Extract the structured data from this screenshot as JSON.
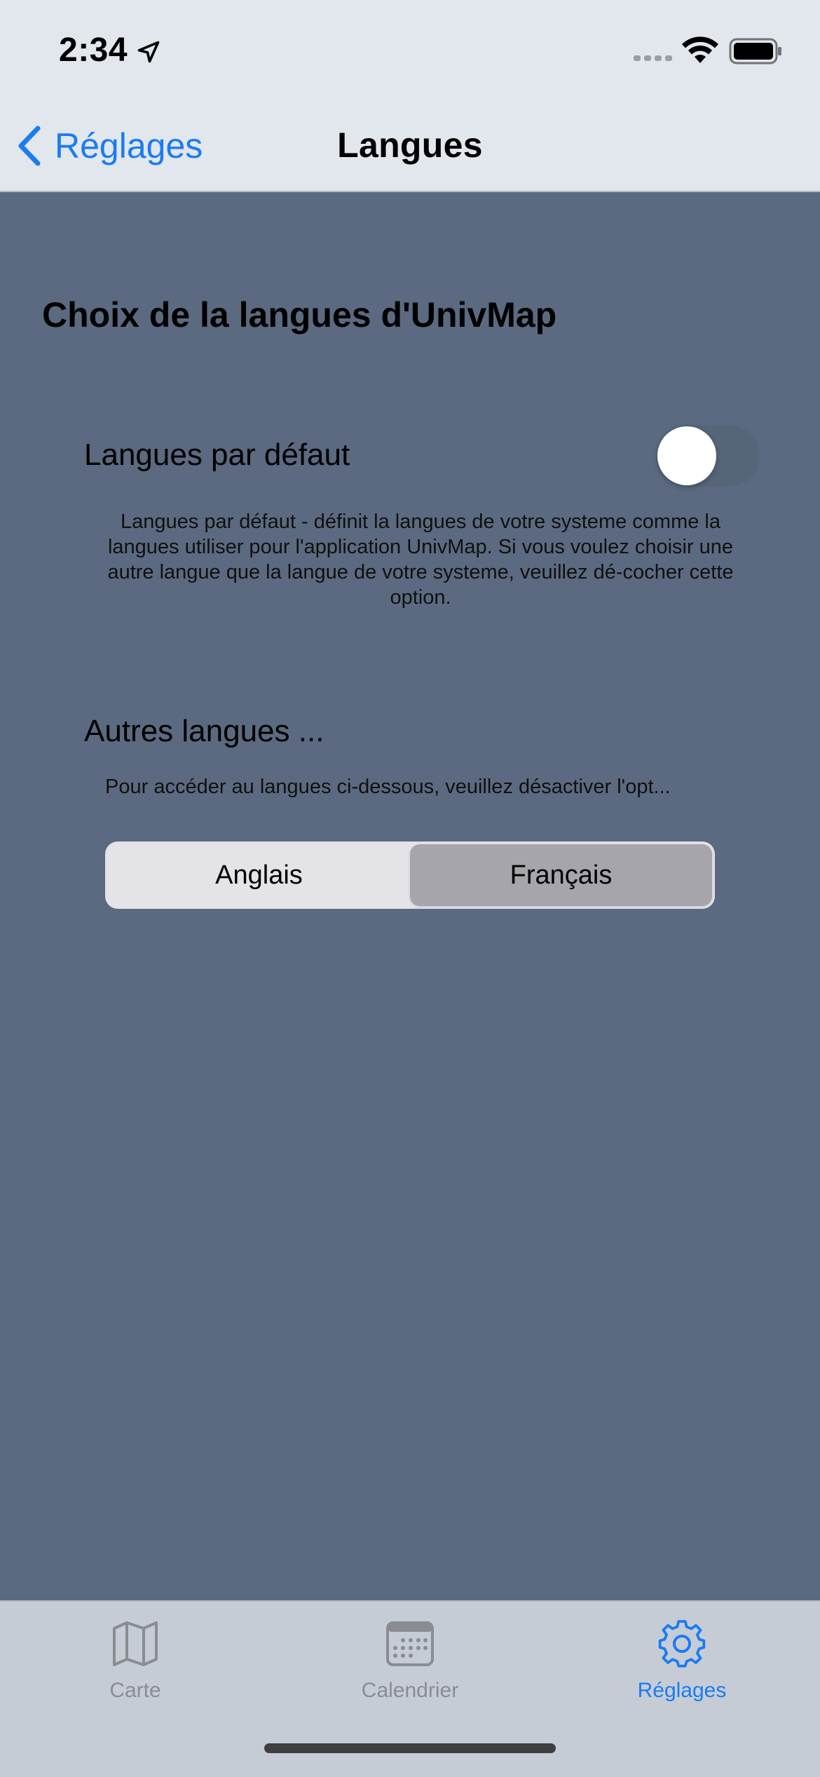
{
  "status_bar": {
    "time": "2:34"
  },
  "nav": {
    "back_label": "Réglages",
    "title": "Langues"
  },
  "content": {
    "section_title": "Choix de la langues d'UnivMap",
    "default_language": {
      "label": "Langues par défaut",
      "toggle_on": false,
      "description": "Langues par défaut - définit la langues de votre systeme comme la langues utiliser pour l'application UnivMap. Si vous voulez choisir une autre langue que la langue de votre systeme, veuillez dé-cocher cette option."
    },
    "other_languages": {
      "title": "Autres langues ...",
      "hint": "Pour accéder au langues ci-dessous, veuillez désactiver l'opt...",
      "options": [
        {
          "label": "Anglais",
          "selected": false
        },
        {
          "label": "Français",
          "selected": true
        }
      ]
    }
  },
  "tabbar": {
    "tabs": [
      {
        "label": "Carte",
        "icon": "map-icon",
        "active": false
      },
      {
        "label": "Calendrier",
        "icon": "calendar-icon",
        "active": false
      },
      {
        "label": "Réglages",
        "icon": "gear-icon",
        "active": true
      }
    ]
  },
  "colors": {
    "accent": "#1a7cf0",
    "background": "#5b6a80",
    "bar_background": "#e2e6ed",
    "tab_inactive": "#8a8c92"
  }
}
